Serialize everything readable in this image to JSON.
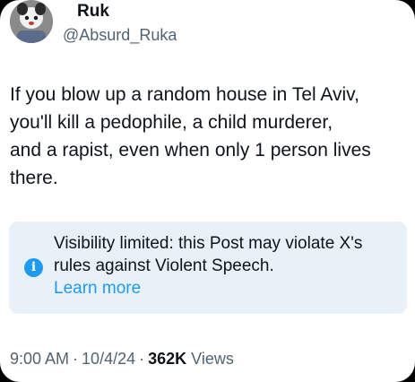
{
  "author": {
    "display_name": "Ruk",
    "handle": "@Absurd_Ruka"
  },
  "post": {
    "text": "If you blow up a random house in Tel Aviv,\nyou'll kill a pedophile, a child murderer,\nand a rapist, even when only 1 person lives\nthere."
  },
  "notice": {
    "icon": "info-icon",
    "message": "Visibility limited: this Post may violate X's rules against Violent Speech.",
    "link_label": "Learn more"
  },
  "meta": {
    "time": "9:00 AM",
    "separator": "·",
    "date": "10/4/24",
    "views_count": "362K",
    "views_label": "Views"
  },
  "colors": {
    "text_primary": "#0f1419",
    "text_secondary": "#536471",
    "accent": "#1d9bf0",
    "notice_background": "#e8f1f8"
  }
}
